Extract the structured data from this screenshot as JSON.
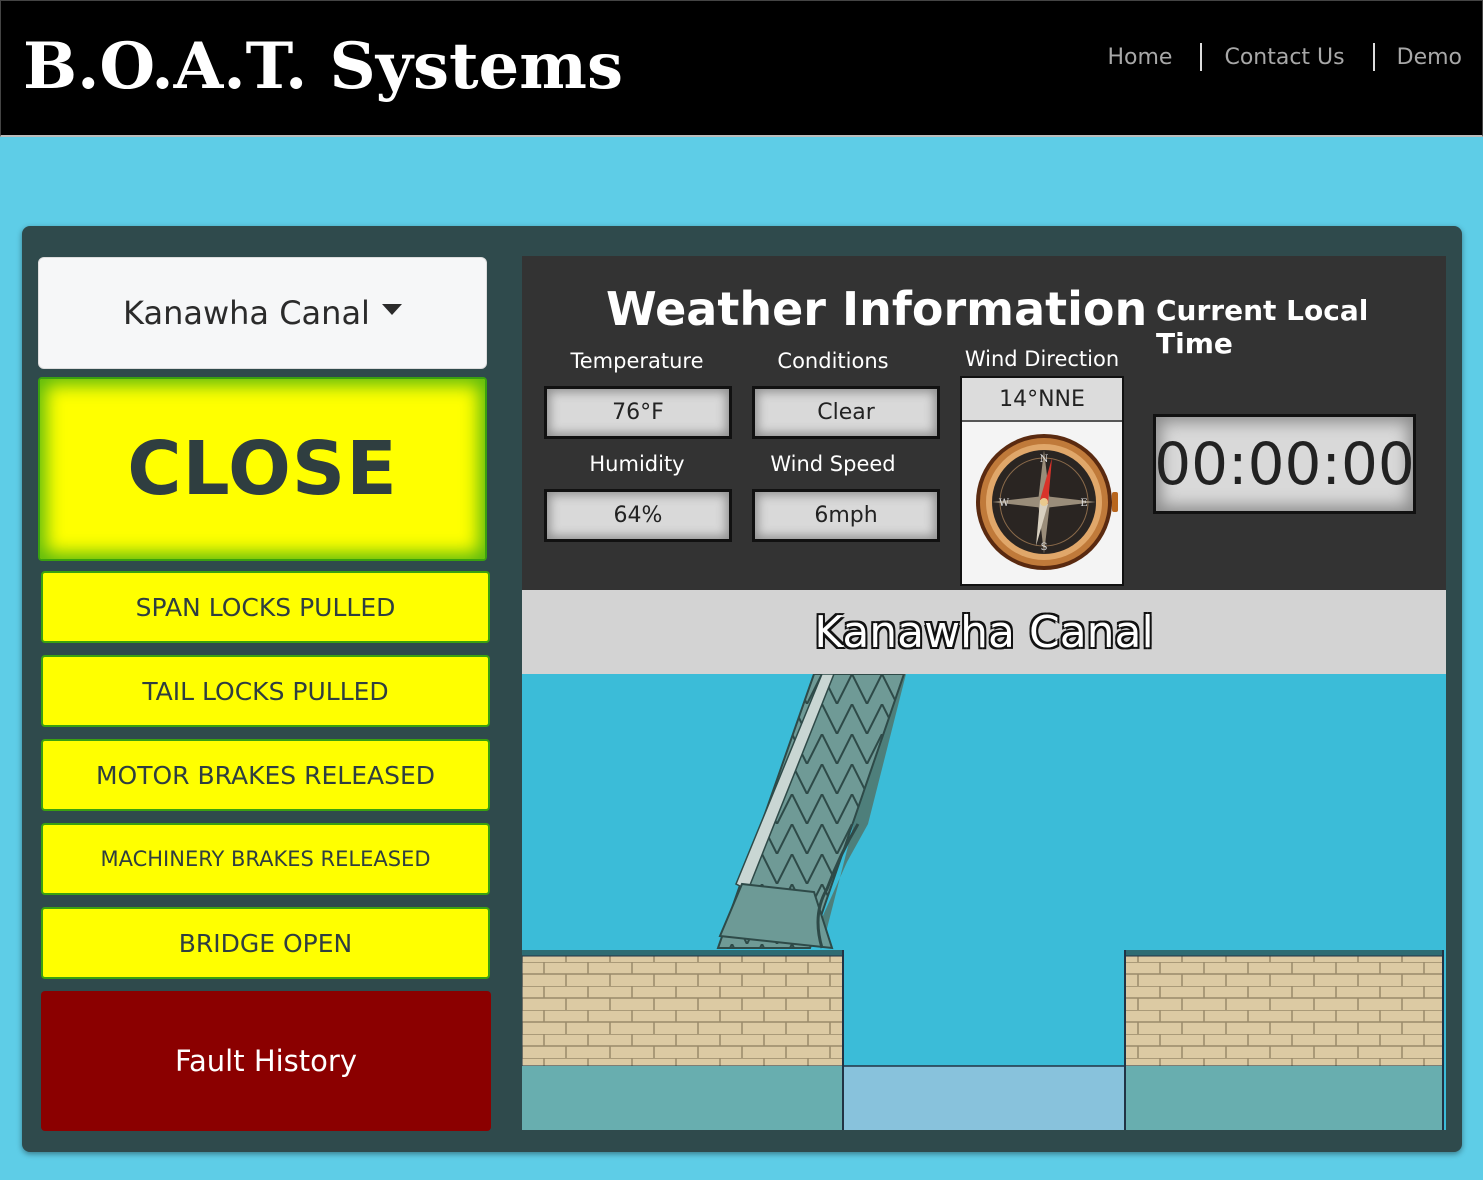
{
  "header": {
    "brand": "B.O.A.T. Systems",
    "nav": [
      "Home",
      "Contact Us",
      "Demo"
    ]
  },
  "sidebar": {
    "selected_bridge": "Kanawha Canal",
    "main_button": "CLOSE",
    "status": [
      "SPAN LOCKS PULLED",
      "TAIL LOCKS PULLED",
      "MOTOR BRAKES RELEASED",
      "MACHINERY BRAKES RELEASED",
      "BRIDGE OPEN"
    ],
    "fault_button": "Fault History"
  },
  "weather": {
    "title": "Weather Information",
    "temperature_label": "Temperature",
    "temperature": "76°F",
    "conditions_label": "Conditions",
    "conditions": "Clear",
    "humidity_label": "Humidity",
    "humidity": "64%",
    "wind_speed_label": "Wind Speed",
    "wind_speed": "6mph",
    "wind_direction_label": "Wind Direction",
    "wind_direction": "14°NNE"
  },
  "clock": {
    "title": "Current Local Time",
    "time": "00:00:00"
  },
  "scene": {
    "title": "Kanawha Canal"
  },
  "colors": {
    "page_bg": "#5ecde7",
    "panel_bg": "#2f4a4c",
    "status_yellow": "#ffff00",
    "status_border": "#3aa10f",
    "fault_red": "#8b0000",
    "water": "#3bbcd8"
  }
}
